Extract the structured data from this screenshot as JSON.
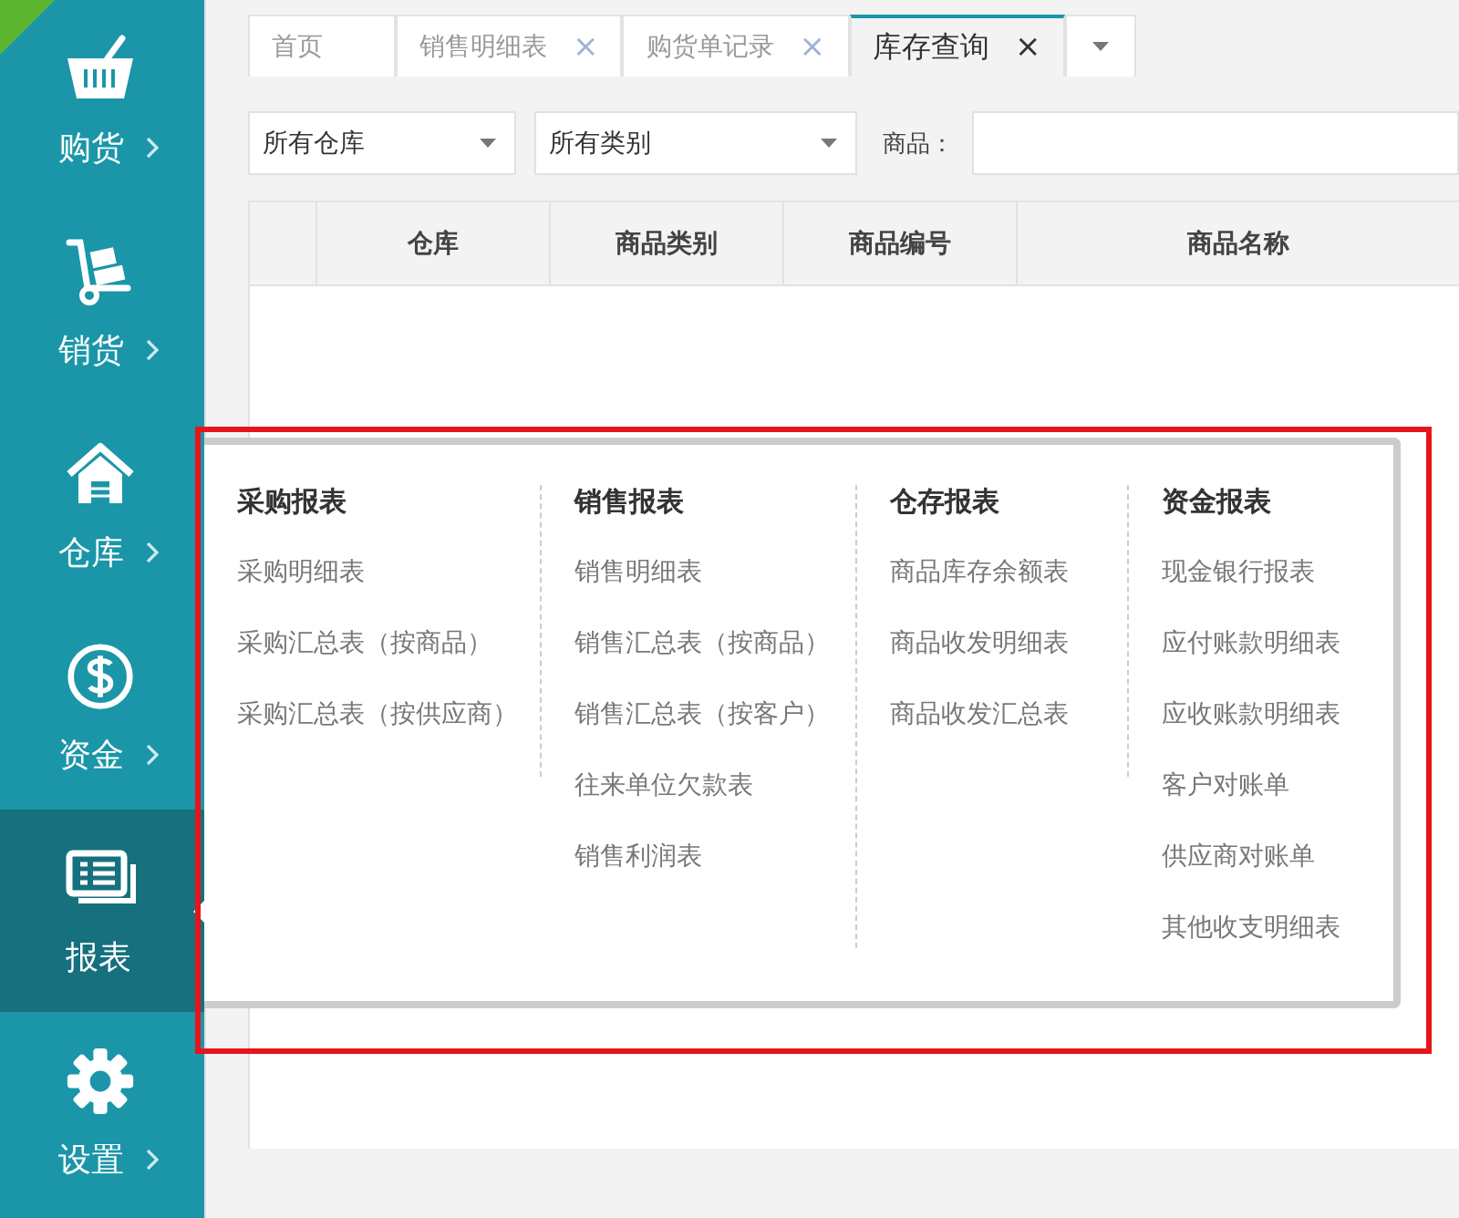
{
  "sidebar": {
    "items": [
      {
        "label": "购货",
        "kind": "basket",
        "selected": false
      },
      {
        "label": "销货",
        "kind": "cart",
        "selected": false
      },
      {
        "label": "仓库",
        "kind": "house",
        "selected": false
      },
      {
        "label": "资金",
        "kind": "dollar",
        "selected": false
      },
      {
        "label": "报表",
        "kind": "report",
        "selected": true
      },
      {
        "label": "设置",
        "kind": "gear",
        "selected": false
      }
    ]
  },
  "tabs": [
    {
      "label": "首页",
      "closable": false,
      "selected": false
    },
    {
      "label": "销售明细表",
      "closable": true,
      "selected": false
    },
    {
      "label": "购货单记录",
      "closable": true,
      "selected": false
    },
    {
      "label": "库存查询",
      "closable": true,
      "selected": true
    }
  ],
  "tab_close_glyph": "×",
  "filters": {
    "warehouse": "所有仓库",
    "category": "所有类别",
    "product_label": "商品："
  },
  "table": {
    "columns": [
      "仓库",
      "商品类别",
      "商品编号",
      "商品名称"
    ]
  },
  "report_menu": {
    "groups": [
      {
        "title": "采购报表",
        "items": [
          "采购明细表",
          "采购汇总表（按商品）",
          "采购汇总表（按供应商）"
        ]
      },
      {
        "title": "销售报表",
        "items": [
          "销售明细表",
          "销售汇总表（按商品）",
          "销售汇总表（按客户）",
          "往来单位欠款表",
          "销售利润表"
        ]
      },
      {
        "title": "仓存报表",
        "items": [
          "商品库存余额表",
          "商品收发明细表",
          "商品收发汇总表"
        ]
      },
      {
        "title": "资金报表",
        "items": [
          "现金银行报表",
          "应付账款明细表",
          "应收账款明细表",
          "客户对账单",
          "供应商对账单",
          "其他收支明细表"
        ]
      }
    ]
  }
}
